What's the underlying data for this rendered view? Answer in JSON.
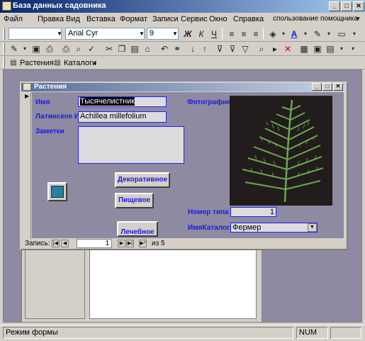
{
  "app": {
    "title": "База данных садовника"
  },
  "menu": {
    "items": [
      "Файл",
      "Правка",
      "Вид",
      "Вставка",
      "Формат",
      "Записи",
      "Сервис",
      "Окно",
      "Справка"
    ],
    "help_placeholder": "спользование помощника"
  },
  "toolbar_format": {
    "font_name": "Arial Cyr",
    "font_size": "9",
    "bold": "Ж",
    "italic": "К",
    "underline": "Ч"
  },
  "toolbar_objects": {
    "tab_plants": "Растения",
    "tab_catalogs": "Каталоги"
  },
  "form": {
    "title": "Растения",
    "labels": {
      "name": "Имя",
      "latin": "Латинское И",
      "notes": "Заметки",
      "photo": "Фотография",
      "type_number": "Номер типа",
      "catalog_name": "ИмяКаталога"
    },
    "values": {
      "name": "Тысячелистник",
      "latin": "Achillea millefolium",
      "notes": "",
      "type_number": "1",
      "catalog_name": "Фермер"
    },
    "buttons": {
      "decorative": "Декоративное",
      "food": "Пищевое",
      "medicinal": "Лечебное"
    }
  },
  "record_nav": {
    "label": "Запись:",
    "current": "1",
    "of_label": "из 5"
  },
  "status": {
    "mode": "Режим формы",
    "num": "NUM"
  },
  "colors": {
    "title_start": "#0a246a",
    "mdi_background": "#8e8aa1",
    "label_blue": "#1a1ae6",
    "fern_green": "#6aa84f"
  }
}
